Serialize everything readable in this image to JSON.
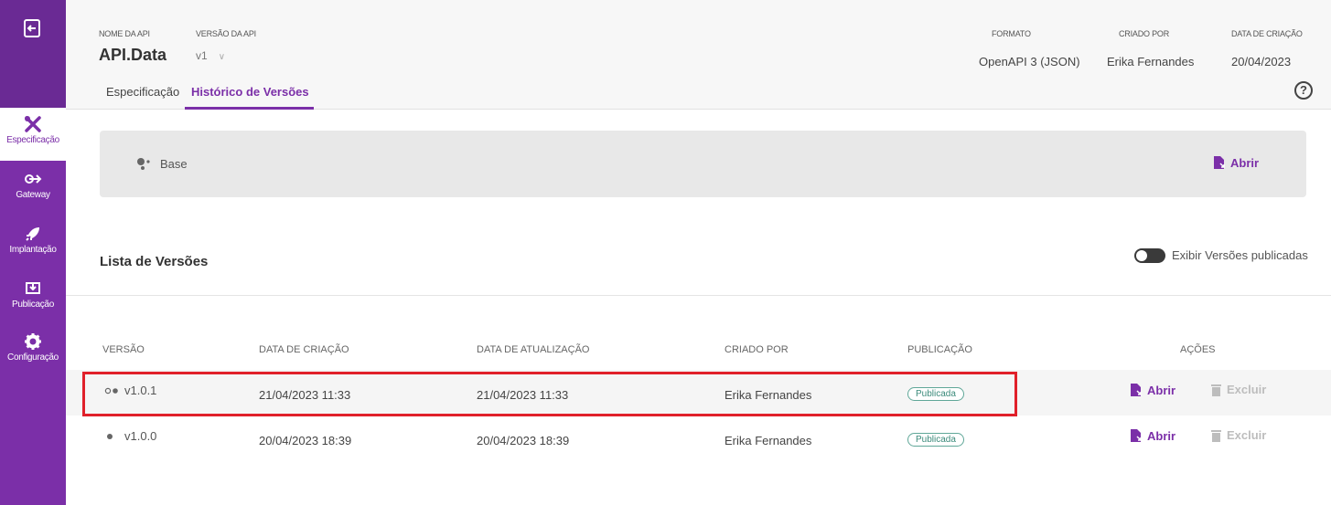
{
  "sidebar": {
    "items": [
      {
        "label": "Especificação",
        "icon": "tools-icon"
      },
      {
        "label": "Gateway",
        "icon": "gateway-icon"
      },
      {
        "label": "Implantação",
        "icon": "rocket-icon"
      },
      {
        "label": "Publicação",
        "icon": "publish-icon"
      },
      {
        "label": "Configuração",
        "icon": "gear-icon"
      }
    ]
  },
  "header": {
    "api_name_label": "NOME DA API",
    "api_name": "API.Data",
    "version_label": "VERSÃO DA API",
    "version": "v1",
    "format_label": "FORMATO",
    "format": "OpenAPI 3 (JSON)",
    "created_by_label": "CRIADO POR",
    "created_by": "Erika Fernandes",
    "created_date_label": "DATA DE CRIAÇÃO",
    "created_date": "20/04/2023",
    "tabs": [
      "Especificação",
      "Histórico de Versões"
    ],
    "help": "?"
  },
  "base": {
    "label": "Base",
    "open_label": "Abrir"
  },
  "list": {
    "title": "Lista de Versões",
    "toggle_label": "Exibir Versões publicadas",
    "columns": [
      "VERSÃO",
      "DATA DE CRIAÇÃO",
      "DATA DE ATUALIZAÇÃO",
      "CRIADO POR",
      "PUBLICAÇÃO",
      "AÇÕES"
    ],
    "rows": [
      {
        "version": "v1.0.1",
        "created": "21/04/2023 11:33",
        "updated": "21/04/2023 11:33",
        "author": "Erika Fernandes",
        "status": "Publicada",
        "open_label": "Abrir",
        "delete_label": "Excluir"
      },
      {
        "version": "v1.0.0",
        "created": "20/04/2023 18:39",
        "updated": "20/04/2023 18:39",
        "author": "Erika Fernandes",
        "status": "Publicada",
        "open_label": "Abrir",
        "delete_label": "Excluir"
      }
    ]
  },
  "colors": {
    "accent": "#7b2fa8",
    "highlight": "#e0202a",
    "badge": "#5fa798"
  }
}
